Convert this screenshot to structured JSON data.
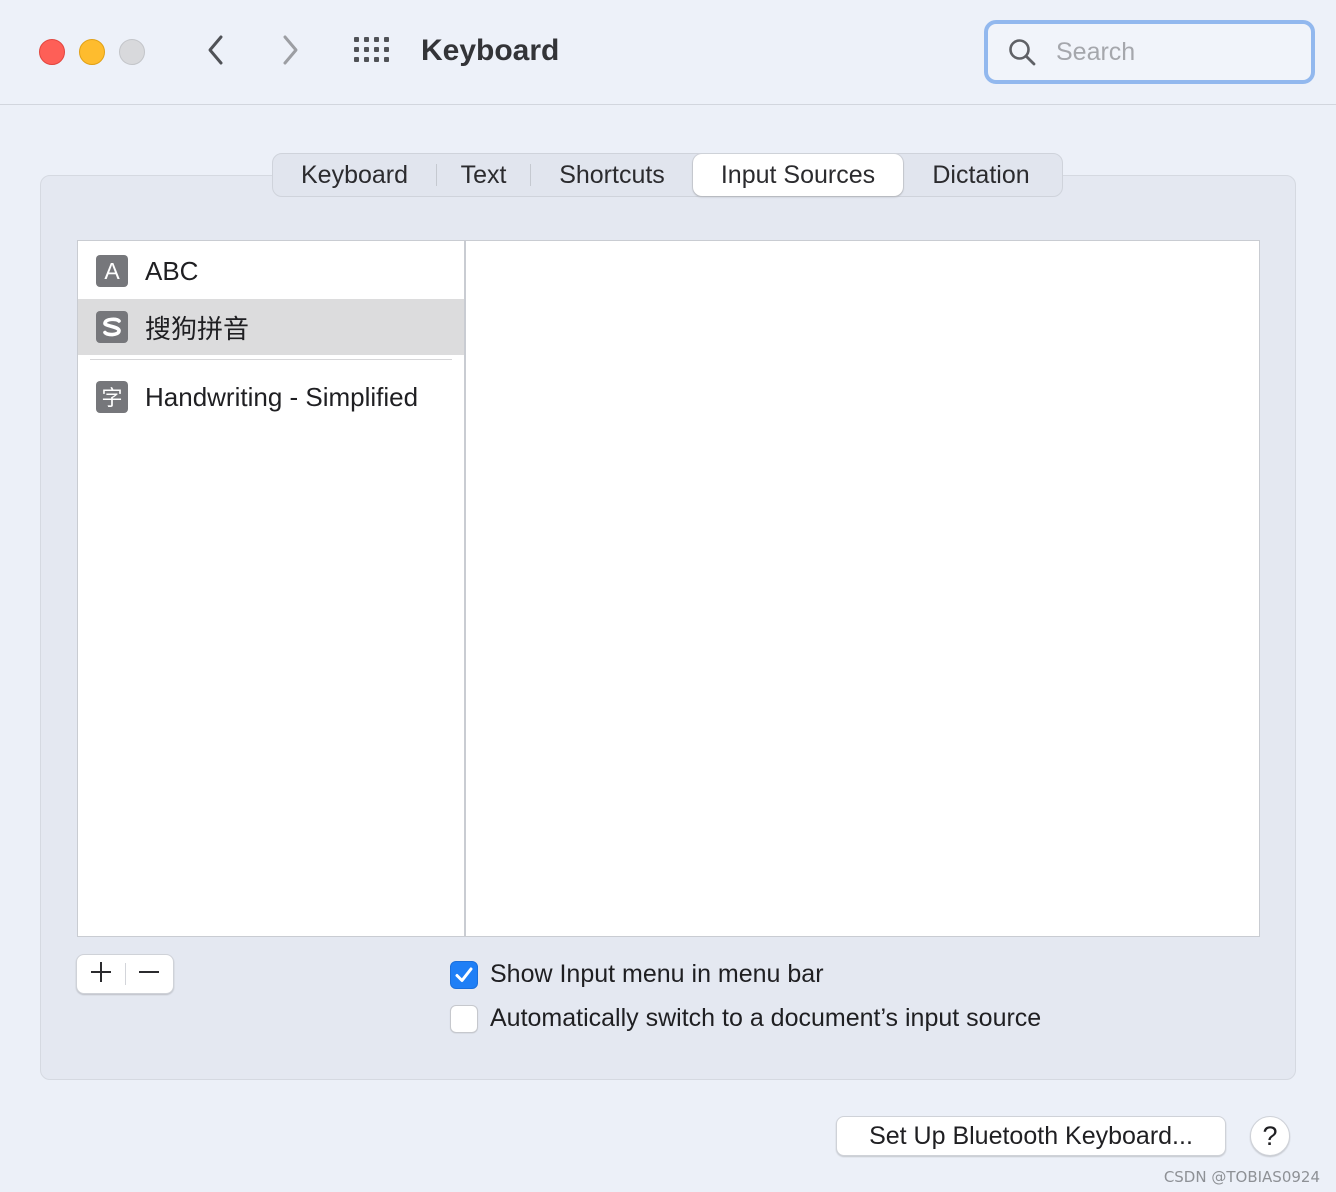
{
  "window": {
    "title": "Keyboard"
  },
  "search": {
    "placeholder": "Search",
    "icon": "magnifier"
  },
  "tabs": [
    {
      "label": "Keyboard",
      "selected": false
    },
    {
      "label": "Text",
      "selected": false
    },
    {
      "label": "Shortcuts",
      "selected": false
    },
    {
      "label": "Input Sources",
      "selected": true
    },
    {
      "label": "Dictation",
      "selected": false
    }
  ],
  "input_sources": [
    {
      "glyph": "A",
      "label": "ABC",
      "selected": false
    },
    {
      "glyph": "S",
      "label": "搜狗拼音",
      "selected": true
    },
    {
      "glyph": "字",
      "label": "Handwriting - Simplified",
      "selected": false
    }
  ],
  "list_controls": {
    "add_label": "+",
    "remove_label": "−"
  },
  "options": {
    "show_input_menu": {
      "label": "Show Input menu in menu bar",
      "checked": true
    },
    "auto_switch": {
      "label": "Automatically switch to a document’s input source",
      "checked": false
    }
  },
  "buttons": {
    "bluetooth": "Set Up Bluetooth Keyboard...",
    "help": "?"
  },
  "watermark": "CSDN @TOBIAS0924",
  "colors": {
    "accent": "#1f7ff6",
    "close": "#fe5f57",
    "minimize": "#febc2e",
    "zoom_disabled": "#d8d9dc",
    "search_focus_ring": "#92b8ee"
  }
}
